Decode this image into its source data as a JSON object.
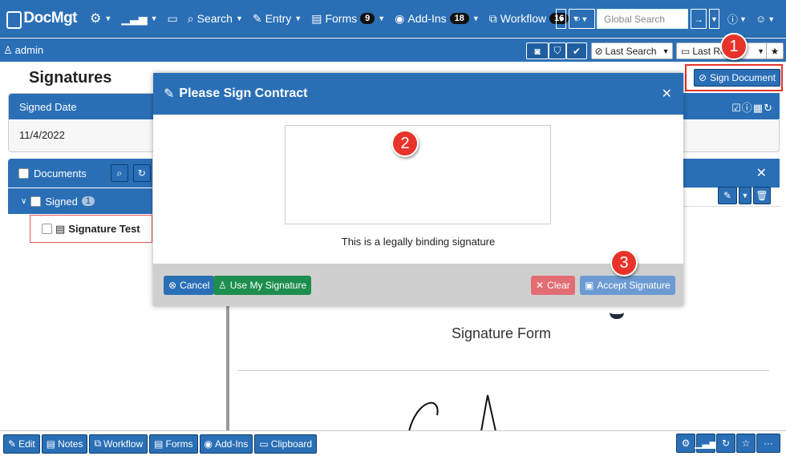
{
  "app": {
    "logo": "DocMgt"
  },
  "topnav": {
    "search": "Search",
    "entry": "Entry",
    "forms": "Forms",
    "forms_count": "9",
    "addins": "Add-Ins",
    "addins_count": "18",
    "workflow": "Workflow",
    "workflow_count": "16",
    "global_search_placeholder": "Global Search"
  },
  "subnav": {
    "user": "admin",
    "last_search": "Last Search",
    "last_re": "Last Re"
  },
  "page": {
    "title": "Signatures",
    "sign_document_button": "Sign Document",
    "signed_date_label": "Signed Date",
    "signed_date_value": "11/4/2022",
    "documents_label": "Documents",
    "signed_folder_label": "Signed",
    "signed_count": "1",
    "document_item": "Signature Test",
    "signature_form_title": "Signature Form"
  },
  "modal": {
    "title": "Please Sign Contract",
    "legal_text": "This is a legally binding signature",
    "cancel": "Cancel",
    "use_my_signature": "Use My Signature",
    "clear": "Clear",
    "accept_signature": "Accept Signature"
  },
  "callouts": {
    "one": "1",
    "two": "2",
    "three": "3"
  },
  "bottombar": {
    "edit": "Edit",
    "notes": "Notes",
    "workflow": "Workflow",
    "forms": "Forms",
    "addins": "Add-Ins",
    "clipboard": "Clipboard",
    "more": "···"
  },
  "colors": {
    "primary": "#2a6fb6",
    "green": "#1e8e4e",
    "red": "#e8332a",
    "clear_btn": "#e26d73",
    "accept_btn": "#6c9bd2"
  }
}
